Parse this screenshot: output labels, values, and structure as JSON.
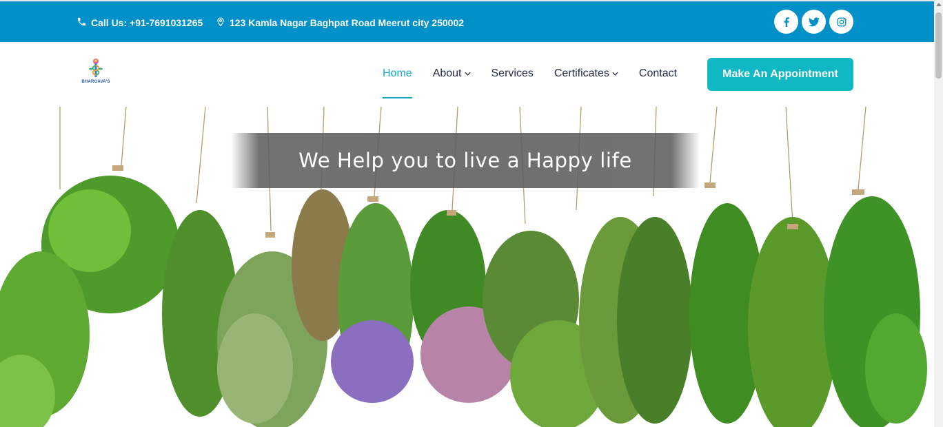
{
  "topbar": {
    "phone": "Call Us: +91-7691031265",
    "address": "123 Kamla Nagar Baghpat Road Meerut city 250002",
    "socials": [
      "facebook-icon",
      "twitter-icon",
      "instagram-icon"
    ],
    "color": "#0290c9"
  },
  "brand": {
    "logo_text": "BHARGAVA'S"
  },
  "nav": {
    "items": [
      {
        "label": "Home",
        "active": true
      },
      {
        "label": "About",
        "dropdown": true
      },
      {
        "label": "Services"
      },
      {
        "label": "Certificates",
        "dropdown": true
      },
      {
        "label": "Contact"
      }
    ],
    "cta": "Make An Appointment",
    "accent": "#19a9c5",
    "cta_color": "#10b8c3"
  },
  "hero": {
    "tagline": "We Help you to live a Happy life"
  }
}
